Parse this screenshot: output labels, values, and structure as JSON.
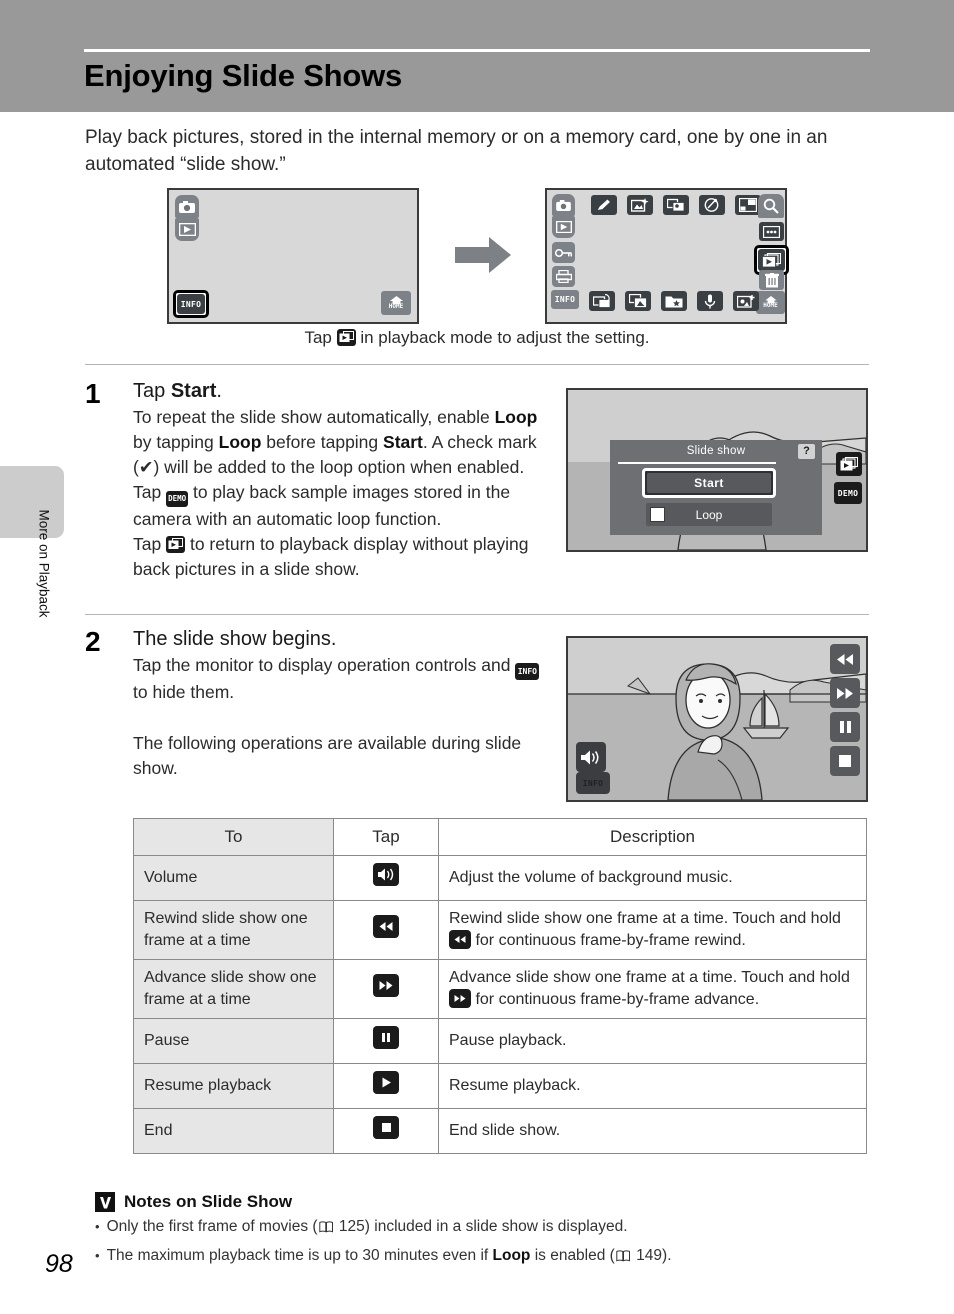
{
  "document": {
    "page_title": "Enjoying Slide Shows",
    "page_number": "98",
    "side_tab_label": "More on Playback"
  },
  "intro": {
    "text": "Play back pictures, stored in the internal memory or on a memory card, one by one in an automated “slide show.”"
  },
  "diagram": {
    "caption_before": "Tap",
    "caption_after": "in playback mode to adjust the setting.",
    "left_screen": {
      "icons": [
        {
          "name": "camera-mode-icon",
          "label": ""
        },
        {
          "name": "playback-mode-icon",
          "label": ""
        },
        {
          "name": "info-button-icon",
          "label": "INFO"
        },
        {
          "name": "home-button-icon",
          "label": "HOME"
        }
      ]
    },
    "right_screen": {
      "top_row": [
        "camera-mode-icon",
        "quick-retouch-icon",
        "d-lighting-icon",
        "skin-softening-icon",
        "paint-icon",
        "small-picture-icon",
        "zoom-icon"
      ],
      "left_column": [
        "camera-mode-icon",
        "playback-mode-icon",
        "protect-icon",
        "print-order-icon",
        "info-button-icon"
      ],
      "right_column": [
        "zoom-icon",
        "thumbnail-icon",
        "slide-show-icon",
        "delete-icon",
        "home-button-icon"
      ],
      "bottom_row": [
        "info-button-icon",
        "rotate-image-icon",
        "copy-icon",
        "favorites-icon",
        "voice-memo-icon",
        "add-frame-icon",
        "home-button-icon"
      ],
      "selected": "slide-show-icon"
    }
  },
  "steps": [
    {
      "number": "1",
      "heading_plain": "Tap ",
      "heading_bold": "Start",
      "heading_tail": ".",
      "lines": [
        "To repeat the slide show automatically, enable",
        "Loop",
        " by tapping ",
        "Loop",
        " before tapping ",
        "Start",
        ". A check mark (✔) will be added to the loop option when enabled.",
        "Tap",
        "to play back sample images stored in the camera with an automatic loop function.",
        "Tap",
        "to return to playback display without playing back pictures in a slide show."
      ]
    },
    {
      "number": "2",
      "heading": "The slide show begins.",
      "line1_before": "Tap the monitor to display operation controls and",
      "line1_after": "to hide them.",
      "line2": "The following operations are available during slide show."
    }
  ],
  "dialog": {
    "title": "Slide show",
    "help_label": "?",
    "start_label": "Start",
    "loop_label": "Loop",
    "side_buttons": [
      "slide-show-icon",
      "demo-icon"
    ],
    "demo_label": "DEMO"
  },
  "playback_screen": {
    "controls": [
      "rewind-icon",
      "advance-icon",
      "pause-icon",
      "stop-icon",
      "volume-icon",
      "info-button-icon"
    ],
    "info_label": "INFO"
  },
  "table": {
    "headers": [
      "To",
      "Tap",
      "Description"
    ],
    "rows": [
      {
        "to": "Volume",
        "tap_icon": "volume-icon",
        "desc": "Adjust the volume of background music.",
        "desc_parts": [
          "Adjust the volume of background music."
        ]
      },
      {
        "to": "Rewind slide show one frame at a time",
        "tap_icon": "rewind-icon",
        "desc_before": "Rewind slide show one frame at a time. Touch and hold",
        "desc_after": "for continuous frame-by-frame rewind.",
        "inline_icon": "rewind-icon"
      },
      {
        "to": "Advance slide show one frame at a time",
        "tap_icon": "advance-icon",
        "desc_before": "Advance slide show one frame at a time. Touch and hold",
        "desc_after": "for continuous frame-by-frame advance.",
        "inline_icon": "advance-icon"
      },
      {
        "to": "Pause",
        "tap_icon": "pause-icon",
        "desc": "Pause playback."
      },
      {
        "to": "Resume playback",
        "tap_icon": "play-icon",
        "desc": "Resume playback."
      },
      {
        "to": "End",
        "tap_icon": "stop-icon",
        "desc": "End slide show."
      }
    ]
  },
  "notes": {
    "title": "Notes on Slide Show",
    "items": [
      {
        "before": "Only the first frame of movies (",
        "ref": "125",
        "after": ") included in a slide show is displayed."
      },
      {
        "before": "The maximum playback time is up to 30 minutes even if ",
        "bold": "Loop",
        "middle": " is enabled (",
        "ref": "149",
        "after": ")."
      }
    ]
  },
  "colors": {
    "header_band": "#999999",
    "side_tab": "#cccccc",
    "screen_bg": "#d8d8d8",
    "table_header": "#e6e6e6"
  }
}
